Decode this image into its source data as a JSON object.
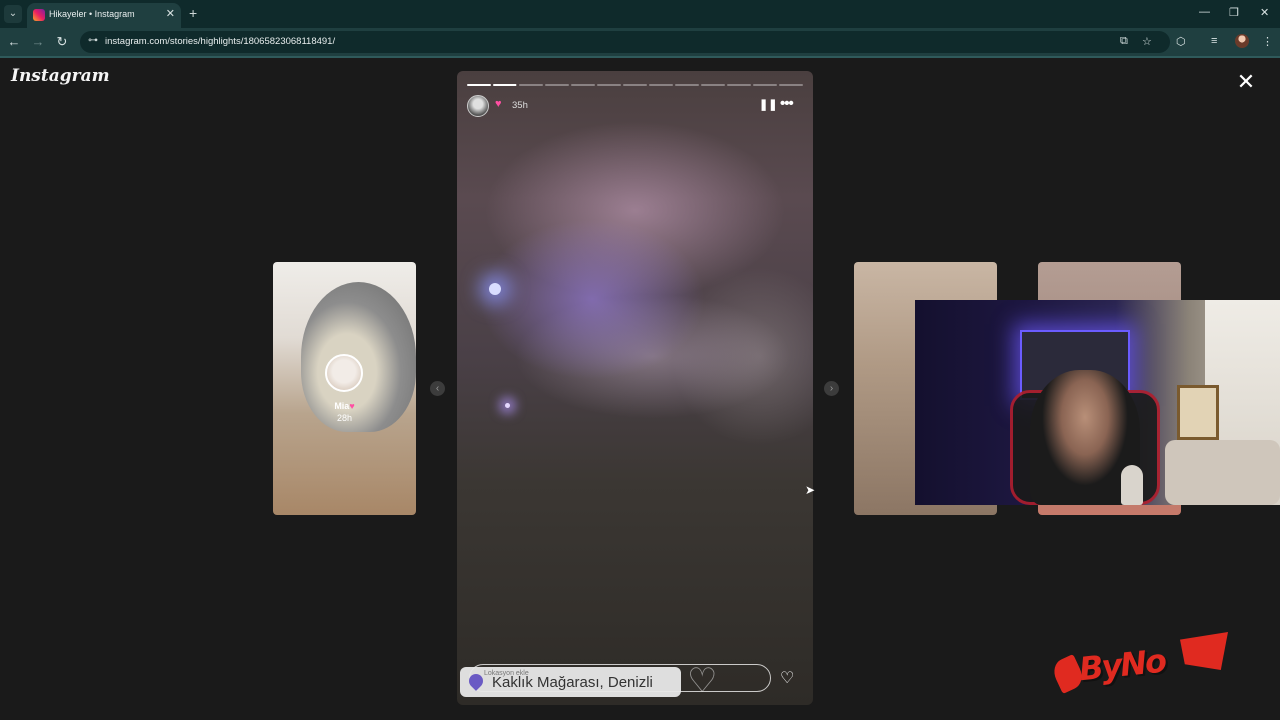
{
  "browser": {
    "tab_title": "Hikayeler • Instagram",
    "tab_list_icon": "⌄",
    "tab_close": "✕",
    "new_tab": "+",
    "url": "instagram.com/stories/highlights/18065823068118491/",
    "win_min": "—",
    "win_restore": "❐",
    "win_close": "✕",
    "back": "←",
    "forward": "→",
    "reload": "↻",
    "site_info": "⊶",
    "install_icon": "⧉",
    "bookmark_icon": "☆",
    "extensions_icon": "⬡",
    "media_icon": "≡",
    "menu_icon": "⋮"
  },
  "instagram": {
    "logo": "Instagram",
    "close": "✕",
    "left_preview": {
      "name": "Mia",
      "heart": "♥",
      "time": "28h"
    },
    "nav_prev": "‹",
    "nav_next": "›",
    "story": {
      "heart": "♥",
      "time": "35h",
      "pause": "❚❚",
      "more": "•••",
      "location_sub": "Lokasyon ekle",
      "location_name": "Kaklık Mağarası, Denizli",
      "big_heart": "♡",
      "like": "♡",
      "segments_total": 13,
      "segments_done": 1
    }
  },
  "watermark": {
    "text": "ByNo"
  },
  "colors": {
    "accent_pink": "#ff4fa3",
    "chrome_bg": "#1f3f40",
    "page_bg": "#1a1a1a",
    "brand_red": "#e02a20"
  }
}
